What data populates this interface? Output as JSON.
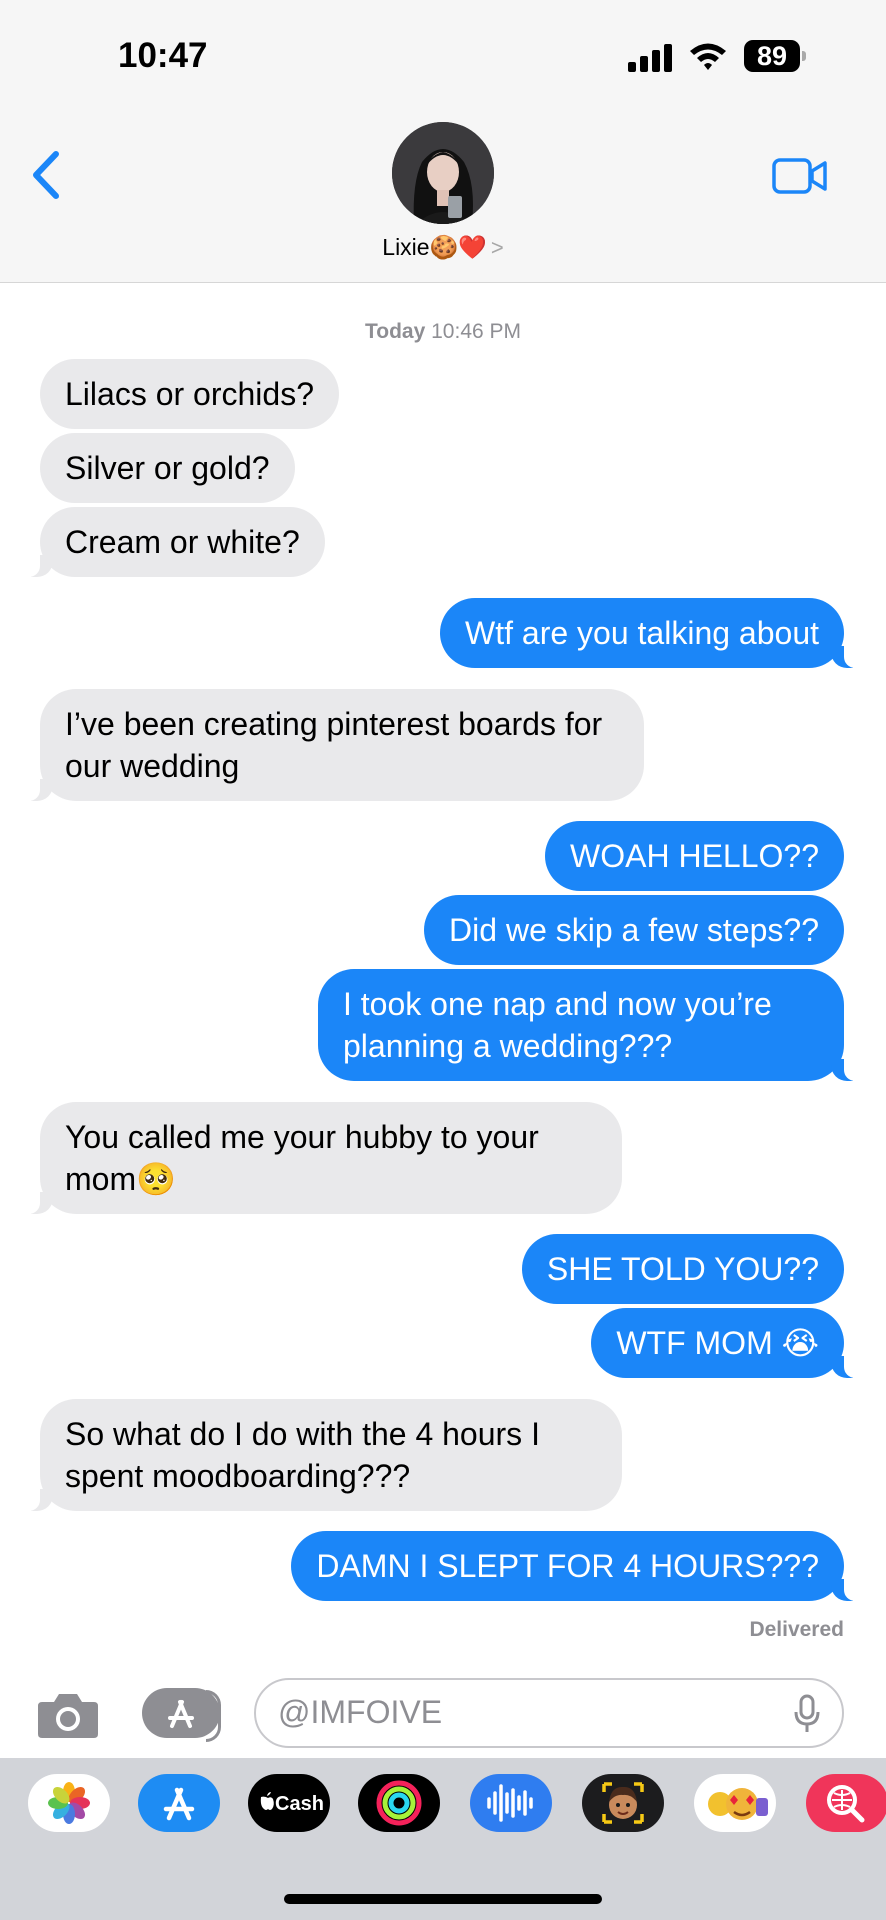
{
  "status": {
    "time": "10:47",
    "battery": "89"
  },
  "header": {
    "contact_name": "Lixie🍪❤️",
    "chevron": ">"
  },
  "thread": {
    "timestamp_day": "Today",
    "timestamp_time": "10:46 PM",
    "messages": [
      {
        "from": "them",
        "text": "Lilacs or orchids?"
      },
      {
        "from": "them",
        "text": "Silver or gold?"
      },
      {
        "from": "them",
        "text": "Cream or white?"
      },
      {
        "from": "me",
        "text": "Wtf are you talking about"
      },
      {
        "from": "them",
        "text": "I’ve been creating pinterest boards for our wedding"
      },
      {
        "from": "me",
        "text": "WOAH HELLO??"
      },
      {
        "from": "me",
        "text": "Did we skip a few steps??"
      },
      {
        "from": "me",
        "text": "I took one nap and now you’re planning a wedding???"
      },
      {
        "from": "them",
        "text": "You called me your hubby to your mom🥺"
      },
      {
        "from": "me",
        "text": "SHE TOLD YOU??"
      },
      {
        "from": "me",
        "text": "WTF MOM 😭"
      },
      {
        "from": "them",
        "text": "So what do I do with the 4 hours I spent moodboarding???"
      },
      {
        "from": "me",
        "text": "DAMN I SLEPT FOR 4 HOURS???"
      }
    ],
    "delivered": "Delivered"
  },
  "composer": {
    "value": "@IMFOIVE"
  },
  "app_drawer": {
    "items": [
      {
        "icon": "photos-icon",
        "label": ""
      },
      {
        "icon": "app-store-icon",
        "label": ""
      },
      {
        "icon": "apple-cash-icon",
        "label": "Cash"
      },
      {
        "icon": "fitness-icon",
        "label": ""
      },
      {
        "icon": "audio-message-icon",
        "label": ""
      },
      {
        "icon": "memoji-icon",
        "label": ""
      },
      {
        "icon": "stickers-icon",
        "label": ""
      },
      {
        "icon": "images-search-icon",
        "label": ""
      }
    ]
  },
  "colors": {
    "accent": "#1b86f8",
    "incoming_bubble": "#e9e9eb",
    "drawer_bg": "#d2d4d9"
  }
}
